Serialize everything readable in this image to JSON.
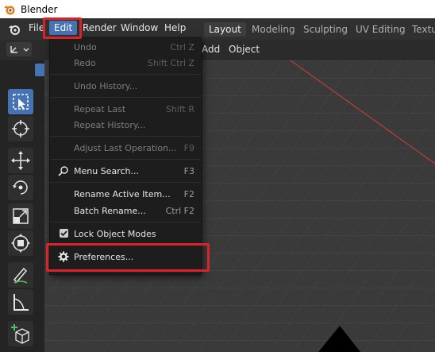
{
  "window": {
    "title": "Blender"
  },
  "menubar": {
    "items": [
      "File",
      "Edit",
      "Render",
      "Window",
      "Help"
    ],
    "tabs": [
      "Layout",
      "Modeling",
      "Sculpting",
      "UV Editing",
      "Textu"
    ]
  },
  "viewport_header": {
    "add": "Add",
    "object": "Object"
  },
  "edit_menu": {
    "items": [
      {
        "label": "Undo",
        "shortcut": "Ctrl Z",
        "enabled": false
      },
      {
        "label": "Redo",
        "shortcut": "Shift Ctrl Z",
        "enabled": false
      },
      {
        "label": "Undo History...",
        "shortcut": "",
        "enabled": false
      },
      {
        "label": "Repeat Last",
        "shortcut": "Shift R",
        "enabled": false
      },
      {
        "label": "Repeat History...",
        "shortcut": "",
        "enabled": false
      },
      {
        "label": "Adjust Last Operation...",
        "shortcut": "F9",
        "enabled": false
      },
      {
        "label": "Menu Search...",
        "shortcut": "F3",
        "enabled": true,
        "icon": "search-icon"
      },
      {
        "label": "Rename Active Item...",
        "shortcut": "F2",
        "enabled": true
      },
      {
        "label": "Batch Rename...",
        "shortcut": "Ctrl F2",
        "enabled": true
      },
      {
        "label": "Lock Object Modes",
        "shortcut": "",
        "enabled": true,
        "checked": true
      },
      {
        "label": "Preferences...",
        "shortcut": "",
        "enabled": true,
        "icon": "gear-icon"
      }
    ]
  },
  "colors": {
    "highlight": "#d9232b",
    "accent": "#4772b3",
    "x_axis": "#c23b3b"
  }
}
